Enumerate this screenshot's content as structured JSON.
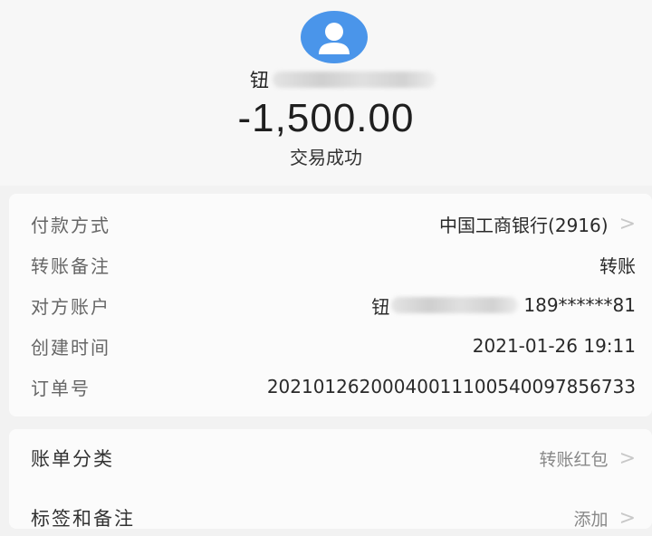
{
  "header": {
    "payee_name_visible": "钮",
    "amount": "-1,500.00",
    "status": "交易成功",
    "avatar_color": "#4a95ea"
  },
  "details": [
    {
      "label": "付款方式",
      "value": "中国工商银行(2916)",
      "chevron": true
    },
    {
      "label": "转账备注",
      "value": "转账",
      "chevron": false
    },
    {
      "label": "对方账户",
      "value_prefix": "钮",
      "value": "189******81",
      "chevron": false
    },
    {
      "label": "创建时间",
      "value": "2021-01-26 19:11",
      "chevron": false
    },
    {
      "label": "订单号",
      "value": "20210126200040011100540097856733",
      "chevron": false
    }
  ],
  "extra": [
    {
      "label": "账单分类",
      "value": "转账红包",
      "chevron": true
    },
    {
      "label": "标签和备注",
      "value": "添加",
      "chevron": true
    }
  ],
  "icons": {
    "avatar": "user-avatar-icon",
    "chevron": "chevron-right-icon",
    "chevron_glyph": ">"
  }
}
